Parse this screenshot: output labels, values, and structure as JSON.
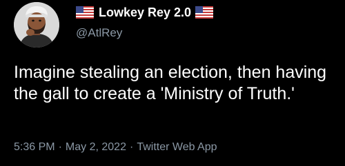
{
  "author": {
    "display_name": "Lowkey Rey 2.0",
    "handle": "@AtlRey",
    "avatar_icon": "bitmoji-avatar-icon",
    "name_flag_icon": "us-flag-icon"
  },
  "tweet": {
    "text": "Imagine stealing an election, then having the gall to create a 'Ministry of Truth.'",
    "time": "5:36 PM",
    "date": "May 2, 2022",
    "source": "Twitter Web App",
    "separator": "·"
  },
  "colors": {
    "background": "#000000",
    "primary_text": "#ffffff",
    "secondary_text": "#8b98a5"
  }
}
